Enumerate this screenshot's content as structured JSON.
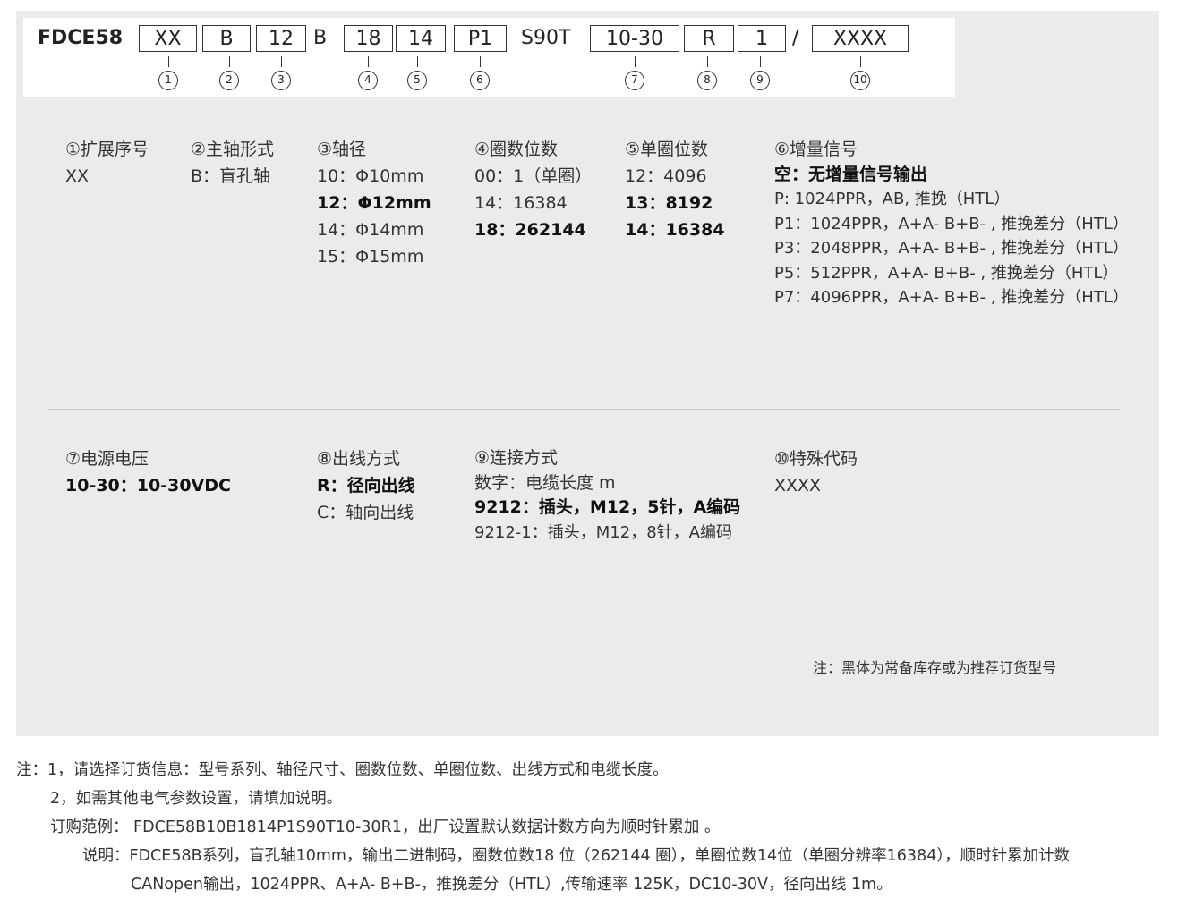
{
  "model_code": {
    "prefix": "FDCE58",
    "fields": [
      {
        "text": "XX",
        "num": "1"
      },
      {
        "text": "B",
        "num": "2"
      },
      {
        "text": "12",
        "num": "3"
      },
      {
        "text": "18",
        "num": "4"
      },
      {
        "text": "14",
        "num": "5"
      },
      {
        "text": "P1",
        "num": "6"
      },
      {
        "text": "10-30",
        "num": "7"
      },
      {
        "text": "R",
        "num": "8"
      },
      {
        "text": "1",
        "num": "9"
      },
      {
        "text": "XXXX",
        "num": "10"
      }
    ],
    "fixed_b": "B",
    "fixed_s90t": "S90T",
    "slash": "/"
  },
  "sections": {
    "s1": {
      "title": "①扩展序号",
      "lines": [
        {
          "text": "XX",
          "bold": false
        }
      ]
    },
    "s2": {
      "title": "②主轴形式",
      "lines": [
        {
          "text": "B：盲孔轴",
          "bold": false
        }
      ]
    },
    "s3": {
      "title": "③轴径",
      "lines": [
        {
          "text": "10：Φ10mm",
          "bold": false
        },
        {
          "text": "12：Φ12mm",
          "bold": true
        },
        {
          "text": "14：Φ14mm",
          "bold": false
        },
        {
          "text": "15：Φ15mm",
          "bold": false
        }
      ]
    },
    "s4": {
      "title": "④圈数位数",
      "lines": [
        {
          "text": "00：1（单圈）",
          "bold": false
        },
        {
          "text": "14：16384",
          "bold": false
        },
        {
          "text": "18：262144",
          "bold": true
        }
      ]
    },
    "s5": {
      "title": "⑤单圈位数",
      "lines": [
        {
          "text": "12：4096",
          "bold": false
        },
        {
          "text": "13：8192",
          "bold": true
        },
        {
          "text": "14：16384",
          "bold": true
        }
      ]
    },
    "s6": {
      "title": "⑥增量信号",
      "lines": [
        {
          "text": "空：无增量信号输出",
          "bold": true
        },
        {
          "text": "P: 1024PPR，AB, 推挽（HTL）",
          "bold": false
        },
        {
          "text": "P1：1024PPR，A+A- B+B- , 推挽差分（HTL）",
          "bold": false
        },
        {
          "text": "P3：2048PPR，A+A- B+B- , 推挽差分（HTL）",
          "bold": false
        },
        {
          "text": "P5：512PPR，A+A- B+B- , 推挽差分（HTL）",
          "bold": false
        },
        {
          "text": "P7：4096PPR，A+A- B+B- , 推挽差分（HTL）",
          "bold": false
        }
      ]
    },
    "s7": {
      "title": "⑦电源电压",
      "lines": [
        {
          "text": "10-30：10-30VDC",
          "bold": true
        }
      ]
    },
    "s8": {
      "title": "⑧出线方式",
      "lines": [
        {
          "text": "R：径向出线",
          "bold": true
        },
        {
          "text": "C：轴向出线",
          "bold": false
        }
      ]
    },
    "s9": {
      "title": "⑨连接方式",
      "lines": [
        {
          "text": "数字：电缆长度 m",
          "bold": false
        },
        {
          "text": "9212：插头，M12，5针，A编码",
          "bold": true
        },
        {
          "text": "9212-1：插头，M12，8针，A编码",
          "bold": false
        }
      ]
    },
    "s10": {
      "title": "⑩特殊代码",
      "lines": [
        {
          "text": "XXXX",
          "bold": false
        }
      ]
    }
  },
  "panel_note": "注：黑体为常备库存或为推荐订货型号",
  "notes": {
    "line1": "注：1，请选择订货信息：型号系列、轴径尺寸、圈数位数、单圈位数、出线方式和电缆长度。",
    "line2": "2，如需其他电气参数设置，请填加说明。",
    "line3": "订购范例：  FDCE58B10B1814P1S90T10-30R1，出厂设置默认数据计数方向为顺时针累加 。",
    "line4": "说明：FDCE58B系列，盲孔轴10mm，输出二进制码，圈数位数18 位（262144 圈），单圈位数14位（单圈分辨率16384），顺时针累加计数",
    "line5": "CANopen输出，1024PPR、A+A- B+B-，推挽差分（HTL）,传输速率 125K，DC10-30V，径向出线 1m。"
  }
}
